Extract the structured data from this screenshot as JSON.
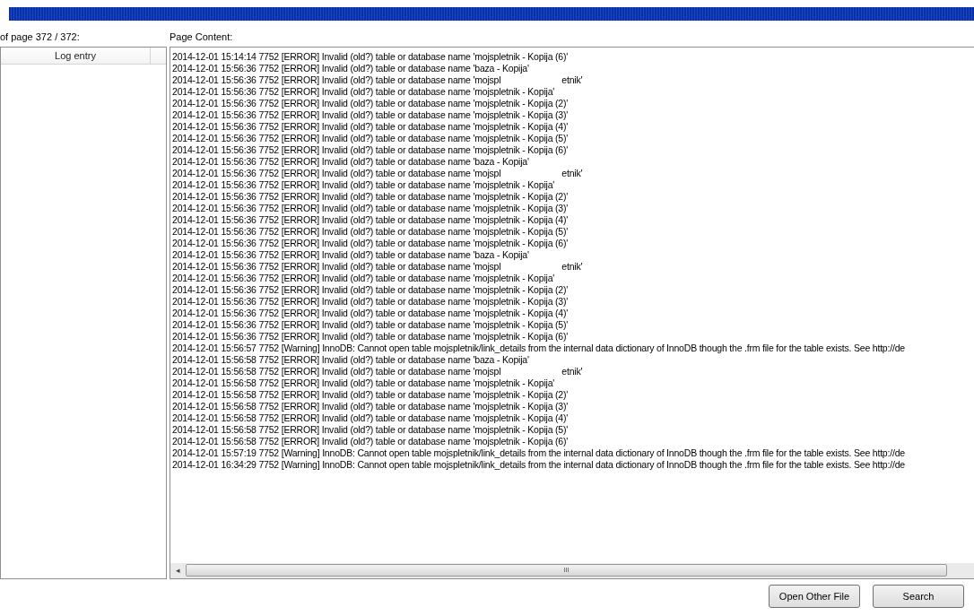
{
  "progress_bar": {
    "level": 1
  },
  "left_panel": {
    "label": "of page 372 / 372:",
    "columns": [
      "Log entry"
    ]
  },
  "page_content": {
    "label": "Page Content:",
    "lines": [
      "2014-12-01 15:14:14 7752 [ERROR] Invalid (old?) table or database name 'mojspletnik - Kopija (6)'",
      "2014-12-01 15:56:36 7752 [ERROR] Invalid (old?) table or database name 'baza - Kopija'",
      "2014-12-01 15:56:36 7752 [ERROR] Invalid (old?) table or database name 'mojspl                         etnik'",
      "2014-12-01 15:56:36 7752 [ERROR] Invalid (old?) table or database name 'mojspletnik - Kopija'",
      "2014-12-01 15:56:36 7752 [ERROR] Invalid (old?) table or database name 'mojspletnik - Kopija (2)'",
      "2014-12-01 15:56:36 7752 [ERROR] Invalid (old?) table or database name 'mojspletnik - Kopija (3)'",
      "2014-12-01 15:56:36 7752 [ERROR] Invalid (old?) table or database name 'mojspletnik - Kopija (4)'",
      "2014-12-01 15:56:36 7752 [ERROR] Invalid (old?) table or database name 'mojspletnik - Kopija (5)'",
      "2014-12-01 15:56:36 7752 [ERROR] Invalid (old?) table or database name 'mojspletnik - Kopija (6)'",
      "2014-12-01 15:56:36 7752 [ERROR] Invalid (old?) table or database name 'baza - Kopija'",
      "2014-12-01 15:56:36 7752 [ERROR] Invalid (old?) table or database name 'mojspl                         etnik'",
      "2014-12-01 15:56:36 7752 [ERROR] Invalid (old?) table or database name 'mojspletnik - Kopija'",
      "2014-12-01 15:56:36 7752 [ERROR] Invalid (old?) table or database name 'mojspletnik - Kopija (2)'",
      "2014-12-01 15:56:36 7752 [ERROR] Invalid (old?) table or database name 'mojspletnik - Kopija (3)'",
      "2014-12-01 15:56:36 7752 [ERROR] Invalid (old?) table or database name 'mojspletnik - Kopija (4)'",
      "2014-12-01 15:56:36 7752 [ERROR] Invalid (old?) table or database name 'mojspletnik - Kopija (5)'",
      "2014-12-01 15:56:36 7752 [ERROR] Invalid (old?) table or database name 'mojspletnik - Kopija (6)'",
      "2014-12-01 15:56:36 7752 [ERROR] Invalid (old?) table or database name 'baza - Kopija'",
      "2014-12-01 15:56:36 7752 [ERROR] Invalid (old?) table or database name 'mojspl                         etnik'",
      "2014-12-01 15:56:36 7752 [ERROR] Invalid (old?) table or database name 'mojspletnik - Kopija'",
      "2014-12-01 15:56:36 7752 [ERROR] Invalid (old?) table or database name 'mojspletnik - Kopija (2)'",
      "2014-12-01 15:56:36 7752 [ERROR] Invalid (old?) table or database name 'mojspletnik - Kopija (3)'",
      "2014-12-01 15:56:36 7752 [ERROR] Invalid (old?) table or database name 'mojspletnik - Kopija (4)'",
      "2014-12-01 15:56:36 7752 [ERROR] Invalid (old?) table or database name 'mojspletnik - Kopija (5)'",
      "2014-12-01 15:56:36 7752 [ERROR] Invalid (old?) table or database name 'mojspletnik - Kopija (6)'",
      "2014-12-01 15:56:57 7752 [Warning] InnoDB: Cannot open table mojspletnik/link_details from the internal data dictionary of InnoDB though the .frm file for the table exists. See http://de",
      "2014-12-01 15:56:58 7752 [ERROR] Invalid (old?) table or database name 'baza - Kopija'",
      "2014-12-01 15:56:58 7752 [ERROR] Invalid (old?) table or database name 'mojspl                         etnik'",
      "2014-12-01 15:56:58 7752 [ERROR] Invalid (old?) table or database name 'mojspletnik - Kopija'",
      "2014-12-01 15:56:58 7752 [ERROR] Invalid (old?) table or database name 'mojspletnik - Kopija (2)'",
      "2014-12-01 15:56:58 7752 [ERROR] Invalid (old?) table or database name 'mojspletnik - Kopija (3)'",
      "2014-12-01 15:56:58 7752 [ERROR] Invalid (old?) table or database name 'mojspletnik - Kopija (4)'",
      "2014-12-01 15:56:58 7752 [ERROR] Invalid (old?) table or database name 'mojspletnik - Kopija (5)'",
      "2014-12-01 15:56:58 7752 [ERROR] Invalid (old?) table or database name 'mojspletnik - Kopija (6)'",
      "2014-12-01 15:57:19 7752 [Warning] InnoDB: Cannot open table mojspletnik/link_details from the internal data dictionary of InnoDB though the .frm file for the table exists. See http://de",
      "2014-12-01 16:34:29 7752 [Warning] InnoDB: Cannot open table mojspletnik/link_details from the internal data dictionary of InnoDB though the .frm file for the table exists. See http://de"
    ],
    "scroll_arrow": "◂",
    "scroll_grip": "III"
  },
  "buttons": [
    "Open Other File",
    "Search"
  ]
}
